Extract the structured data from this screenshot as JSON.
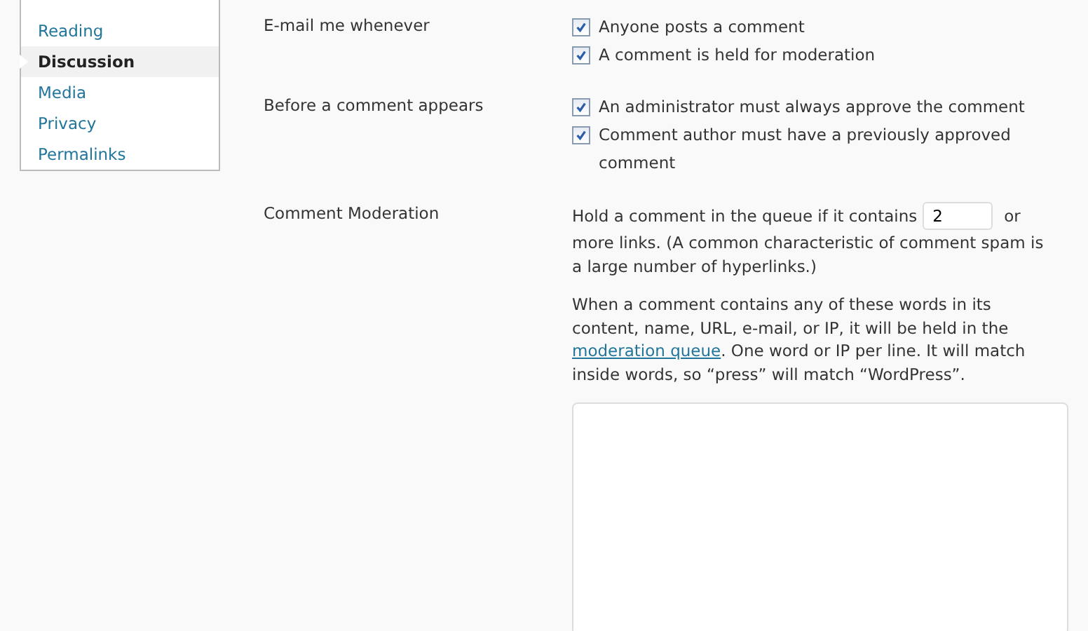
{
  "sidebar": {
    "items": [
      {
        "label": "Reading",
        "selected": false
      },
      {
        "label": "Discussion",
        "selected": true
      },
      {
        "label": "Media",
        "selected": false
      },
      {
        "label": "Privacy",
        "selected": false
      },
      {
        "label": "Permalinks",
        "selected": false
      }
    ]
  },
  "settings": [
    {
      "kind": "checkboxes",
      "label": "E-mail me whenever",
      "options": [
        {
          "label": "Anyone posts a comment",
          "checked": true
        },
        {
          "label": "A comment is held for moderation",
          "checked": true
        }
      ]
    },
    {
      "kind": "checkboxes",
      "label": "Before a comment appears",
      "options": [
        {
          "label": "An administrator must always approve the comment",
          "checked": true
        },
        {
          "label": "Comment author must have a previously approved comment",
          "checked": true
        }
      ]
    },
    {
      "kind": "moderation",
      "label": "Comment Moderation",
      "links_text_before": "Hold a comment in the queue if it contains",
      "links_value": "2",
      "links_text_after": "or",
      "links_text_rest": "more links. (A common characteristic of comment spam is a large number of hyperlinks.)",
      "words_text_before": "When a comment contains any of these words in its content, name, URL, e-mail, or IP, it will be held in the",
      "words_link": "moderation queue",
      "words_text_after": ". One word or IP per line. It will match inside words, so “press” will match “WordPress”."
    }
  ]
}
